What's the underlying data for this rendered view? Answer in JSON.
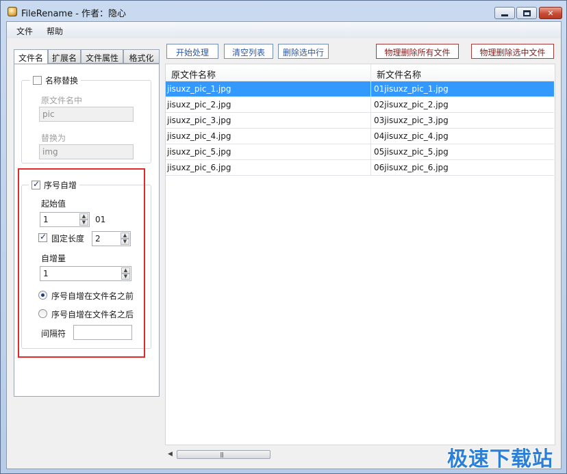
{
  "window": {
    "title": "FileRename - 作者：隐心",
    "controls": {
      "minimize": "minimize-icon",
      "maximize": "maximize-icon",
      "close": "close-icon"
    }
  },
  "menu": [
    "文件",
    "帮助"
  ],
  "tabs": [
    "文件名",
    "扩展名",
    "文件属性",
    "格式化"
  ],
  "name_replace": {
    "label": "名称替换",
    "checked": false,
    "find_label": "原文件名中",
    "find_value": "pic",
    "replace_label": "替换为",
    "replace_value": "img"
  },
  "serial": {
    "label": "序号自增",
    "checked": true,
    "start_label": "起始值",
    "start_value": "1",
    "preview": "01",
    "fixed_len_label": "固定长度",
    "fixed_len_checked": true,
    "fixed_len_value": "2",
    "step_label": "自增量",
    "step_value": "1",
    "before_label": "序号自增在文件名之前",
    "after_label": "序号自增在文件名之后",
    "selected_position": "before",
    "separator_label": "间隔符",
    "separator_value": ""
  },
  "toolbar": {
    "start": "开始处理",
    "clear": "清空列表",
    "remove_selected": "删除选中行",
    "delete_all_files": "物理删除所有文件",
    "delete_selected_files": "物理删除选中文件"
  },
  "list": {
    "headers": [
      "原文件名称",
      "新文件名称"
    ],
    "rows": [
      [
        "jisuxz_pic_1.jpg",
        "01jisuxz_pic_1.jpg"
      ],
      [
        "jisuxz_pic_2.jpg",
        "02jisuxz_pic_2.jpg"
      ],
      [
        "jisuxz_pic_3.jpg",
        "03jisuxz_pic_3.jpg"
      ],
      [
        "jisuxz_pic_4.jpg",
        "04jisuxz_pic_4.jpg"
      ],
      [
        "jisuxz_pic_5.jpg",
        "05jisuxz_pic_5.jpg"
      ],
      [
        "jisuxz_pic_6.jpg",
        "06jisuxz_pic_6.jpg"
      ]
    ],
    "selected_row": 0
  },
  "watermark": "极速下载站",
  "colors": {
    "selection": "#3399ff",
    "highlight_frame": "#e02a2a",
    "watermark": "#2b7fd6"
  }
}
